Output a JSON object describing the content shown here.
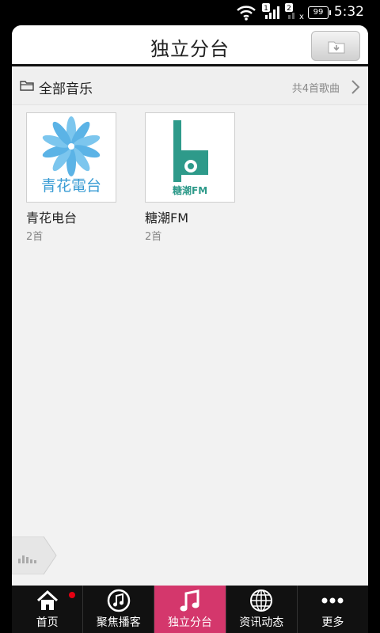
{
  "status_bar": {
    "time": "5:32",
    "battery": "99"
  },
  "header": {
    "title": "独立分台"
  },
  "section": {
    "label": "全部音乐",
    "count": "共4首歌曲"
  },
  "stations": [
    {
      "name": "青花电台",
      "count": "2首",
      "cover_text": "青花電台"
    },
    {
      "name": "糖潮FM",
      "count": "2首",
      "cover_text": "糖潮FM"
    }
  ],
  "nav": [
    {
      "label": "首页",
      "icon": "home-icon"
    },
    {
      "label": "聚焦播客",
      "icon": "music-note-circle-icon"
    },
    {
      "label": "独立分台",
      "icon": "music-note-icon",
      "active": true
    },
    {
      "label": "资讯动态",
      "icon": "globe-icon"
    },
    {
      "label": "更多",
      "icon": "more-dots-icon"
    }
  ],
  "colors": {
    "accent": "#d4376c",
    "badge": "#e60012"
  }
}
